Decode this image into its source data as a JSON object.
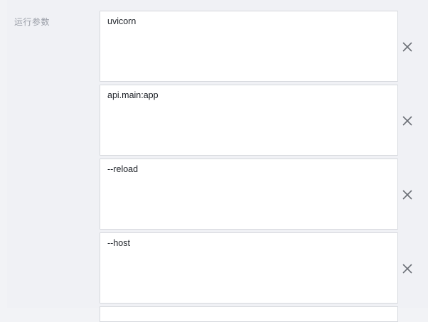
{
  "section": {
    "label": "运行参数"
  },
  "args": [
    {
      "value": "uvicorn"
    },
    {
      "value": "api.main:app"
    },
    {
      "value": "--reload"
    },
    {
      "value": "--host"
    }
  ],
  "icons": {
    "remove": "close-icon"
  },
  "colors": {
    "background": "#f0f1f5",
    "border": "#d6d8dd",
    "label": "#9a9ea7",
    "icon": "#6b6f76"
  }
}
